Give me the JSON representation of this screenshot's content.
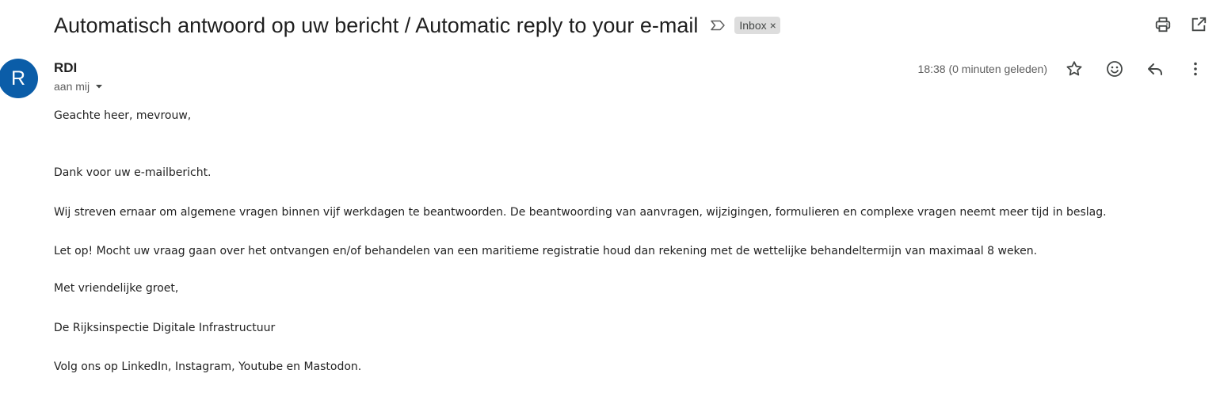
{
  "subject": "Automatisch antwoord op uw bericht / Automatic reply to your e-mail",
  "labels": [
    {
      "name": "Inbox",
      "remove_symbol": "×"
    }
  ],
  "toolbar_icons": [
    "print-icon",
    "open-in-new-window-icon"
  ],
  "sender": {
    "avatar_letter": "R",
    "avatar_color": "#0b5da8",
    "name": "RDI",
    "recipient": "aan mij",
    "timestamp": "18:38 (0 minuten geleden)"
  },
  "message_actions": [
    "star-icon",
    "emoji-reaction-icon",
    "reply-icon",
    "more-options-icon"
  ],
  "body": {
    "greeting": "Geachte heer, mevrouw,",
    "p1": "Dank voor uw e-mailbericht.",
    "p2": "Wij streven ernaar om algemene vragen binnen vijf werkdagen te beantwoorden. De beantwoording van aanvragen, wijzigingen, formulieren en complexe vragen neemt meer tijd in beslag.",
    "p3": "Let op! Mocht uw vraag gaan over het ontvangen en/of behandelen van een maritieme registratie houd dan rekening met de wettelijke behandeltermijn van maximaal 8 weken.",
    "closing": "Met vriendelijke groet,",
    "signature": "De Rijksinspectie Digitale Infrastructuur",
    "social": "Volg ons op LinkedIn, Instagram, Youtube en Mastodon."
  }
}
